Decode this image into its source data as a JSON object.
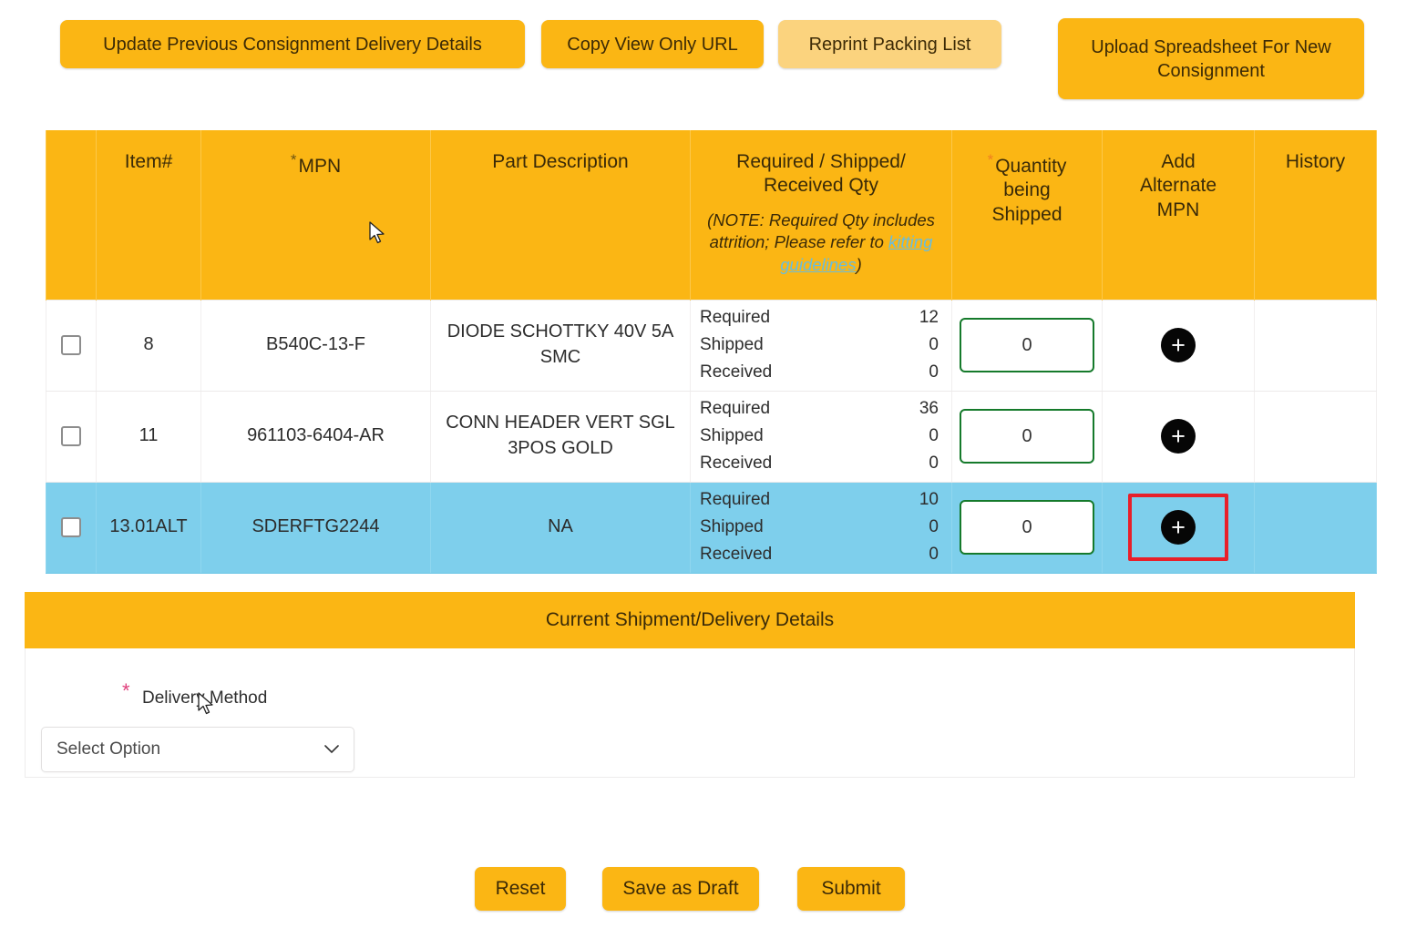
{
  "toolbar": {
    "update_delivery_label": "Update Previous Consignment Delivery Details",
    "copy_url_label": "Copy View Only URL",
    "reprint_label": "Reprint Packing List",
    "upload_label": "Upload Spreadsheet For New Consignment"
  },
  "table": {
    "headers": {
      "checkbox": "",
      "item": "Item#",
      "mpn": "MPN",
      "mpn_required_marker": "*",
      "description": "Part Description",
      "qty_title_line1": "Required / Shipped/",
      "qty_title_line2": "Received Qty",
      "qty_note_pre": "(NOTE: Required Qty includes attrition; Please refer to ",
      "qty_note_link": "kitting guidelines",
      "qty_note_post": ")",
      "shipping_line1": "Quantity",
      "shipping_line2": "being",
      "shipping_line3": "Shipped",
      "shipping_required_marker": "*",
      "alt_line1": "Add",
      "alt_line2": "Alternate",
      "alt_line3": "MPN",
      "history": "History"
    },
    "qty_labels": {
      "required": "Required",
      "shipped": "Shipped",
      "received": "Received"
    },
    "add_icon_label": "+",
    "rows": [
      {
        "item": "8",
        "mpn": "B540C-13-F",
        "description": "DIODE SCHOTTKY 40V 5A SMC",
        "required": "12",
        "shipped": "0",
        "received": "0",
        "qty_being_shipped": "0",
        "highlighted": false,
        "add_focused": false
      },
      {
        "item": "11",
        "mpn": "961103-6404-AR",
        "description": "CONN HEADER VERT SGL 3POS GOLD",
        "required": "36",
        "shipped": "0",
        "received": "0",
        "qty_being_shipped": "0",
        "highlighted": false,
        "add_focused": false
      },
      {
        "item": "13.01ALT",
        "mpn": "SDERFTG2244",
        "description": "NA",
        "required": "10",
        "shipped": "0",
        "received": "0",
        "qty_being_shipped": "0",
        "highlighted": true,
        "add_focused": true
      }
    ]
  },
  "shipment_panel": {
    "title": "Current Shipment/Delivery Details",
    "delivery_method_label": "Delivery Method",
    "delivery_method_required_marker": "*",
    "delivery_method_value": "Select Option",
    "chevron": "⌄"
  },
  "actions": {
    "reset_label": "Reset",
    "save_draft_label": "Save as Draft",
    "submit_label": "Submit"
  },
  "colors": {
    "brand_orange": "#FBB614",
    "reprint_orange_light": "#FBD37E",
    "row_highlight_blue": "#7ECFEC",
    "input_border_green": "#157A2B",
    "focus_outline_red": "#E8202A",
    "link_blue": "#67BDE0",
    "required_star_pink": "#E0407C",
    "required_star_orange": "#F07F20"
  }
}
